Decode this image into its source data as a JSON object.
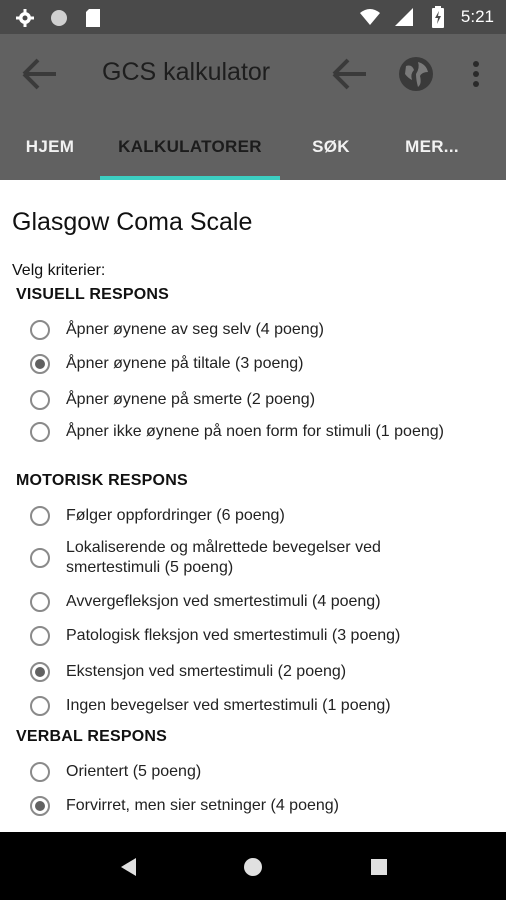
{
  "status_bar": {
    "time": "5:21",
    "left_icons": [
      "gear-icon",
      "circle-icon",
      "sd-card-icon"
    ],
    "right_icons": [
      "wifi-icon",
      "signal-icon",
      "battery-icon"
    ]
  },
  "app_bar": {
    "title": "GCS kalkulator",
    "icons": [
      "back-arrow-icon",
      "back-arrow-icon",
      "globe-icon",
      "more-vert-icon"
    ]
  },
  "tabs": [
    {
      "label": "HJEM",
      "active": false
    },
    {
      "label": "KALKULATORER",
      "active": true
    },
    {
      "label": "SØK",
      "active": false
    },
    {
      "label": "MER...",
      "active": false
    }
  ],
  "page": {
    "title": "Glasgow Coma Scale",
    "criteria_label": "Velg kriterier:"
  },
  "sections": [
    {
      "title": "VISUELL RESPONS",
      "options": [
        {
          "label": "Åpner øynene av seg selv (4 poeng)",
          "checked": false
        },
        {
          "label": "Åpner øynene på tiltale (3 poeng)",
          "checked": true
        },
        {
          "label": "Åpner øynene på smerte (2 poeng)",
          "checked": false
        },
        {
          "label": "Åpner ikke øynene på noen form for stimuli (1 poeng)",
          "checked": false
        }
      ]
    },
    {
      "title": "MOTORISK RESPONS",
      "options": [
        {
          "label": "Følger oppfordringer (6 poeng)",
          "checked": false
        },
        {
          "label": "Lokaliserende og målrettede bevegelser ved smertestimuli (5 poeng)",
          "checked": false
        },
        {
          "label": "Avvergefleksjon ved smertestimuli (4 poeng)",
          "checked": false
        },
        {
          "label": "Patologisk fleksjon ved smertestimuli (3 poeng)",
          "checked": false
        },
        {
          "label": "Ekstensjon ved smertestimuli (2 poeng)",
          "checked": true
        },
        {
          "label": "Ingen bevegelser ved smertestimuli (1 poeng)",
          "checked": false
        }
      ]
    },
    {
      "title": "VERBAL RESPONS",
      "options": [
        {
          "label": "Orientert (5 poeng)",
          "checked": false
        },
        {
          "label": "Forvirret, men sier setninger (4 poeng)",
          "checked": true
        }
      ]
    }
  ],
  "nav_bar": {
    "icons": [
      "back-triangle-icon",
      "home-circle-icon",
      "recents-square-icon"
    ]
  },
  "colors": {
    "app_bar": "#616161",
    "status_bar": "#4a4a4a",
    "tab_indicator": "#3ccfc2",
    "nav_bar": "#000000"
  }
}
